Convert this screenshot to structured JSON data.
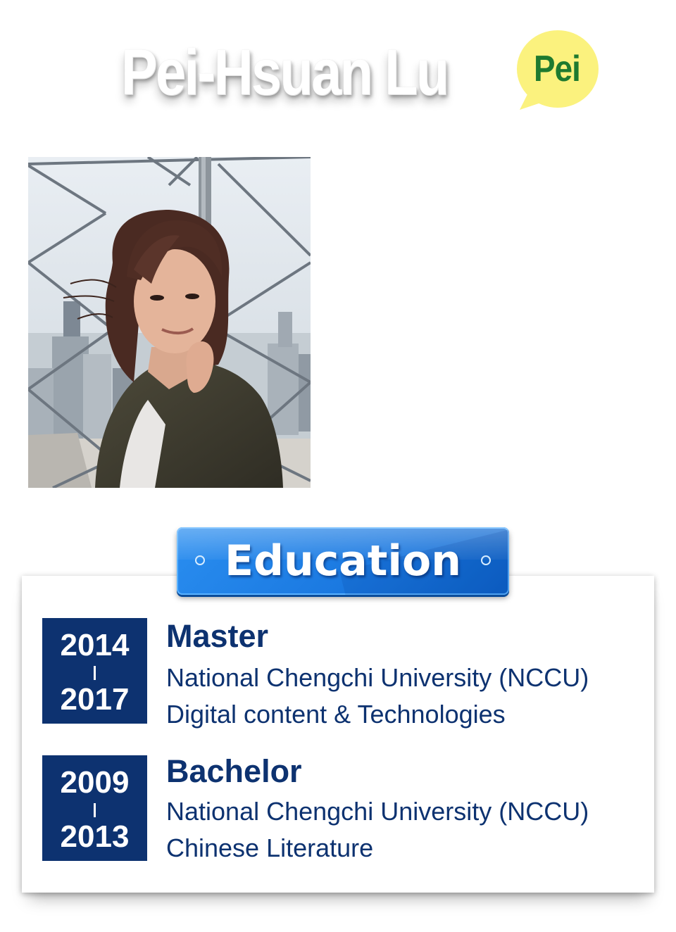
{
  "header": {
    "name": "Pei-Hsuan Lu",
    "nickname": "Pei"
  },
  "portrait": {
    "icon": "person-photo"
  },
  "education": {
    "title": "Education",
    "colors": {
      "banner": "#1a78e0",
      "year_box": "#0d3270",
      "text": "#0d3270"
    },
    "entries": [
      {
        "start": "2014",
        "end": "2017",
        "degree": "Master",
        "school": "National Chengchi University (NCCU)",
        "field": "Digital content & Technologies"
      },
      {
        "start": "2009",
        "end": "2013",
        "degree": "Bachelor",
        "school": "National Chengchi University (NCCU)",
        "field": "Chinese Literature"
      }
    ]
  }
}
